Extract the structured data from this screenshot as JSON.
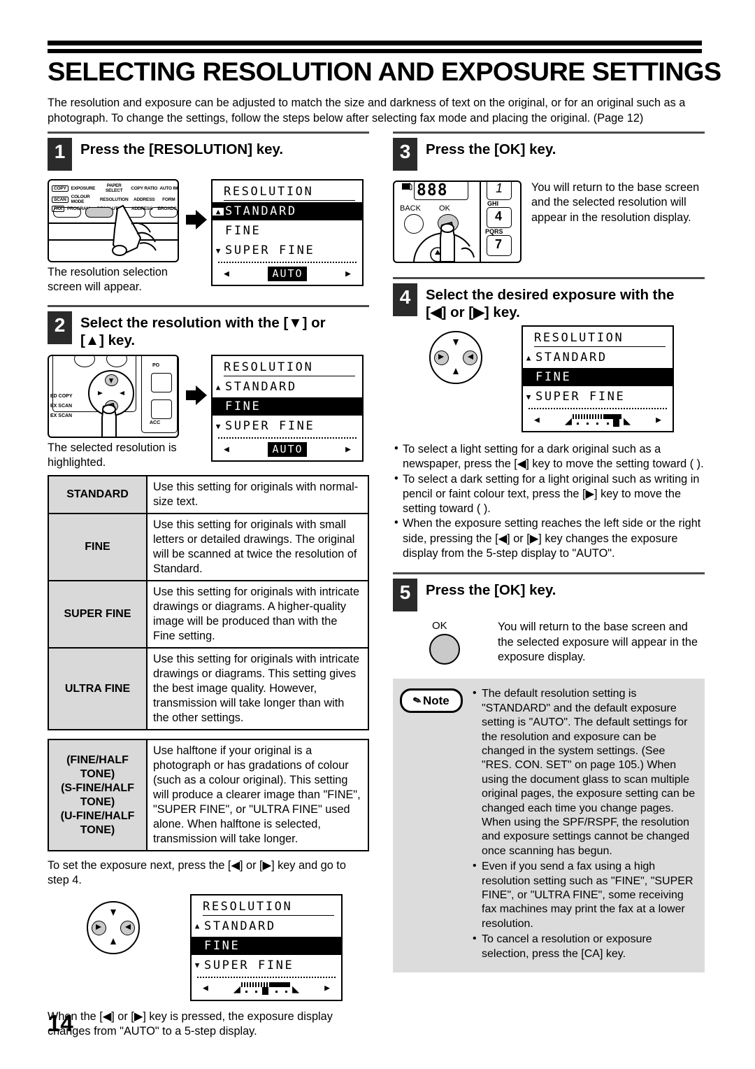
{
  "document": {
    "title": "SELECTING RESOLUTION AND EXPOSURE SETTINGS",
    "intro": "The resolution and exposure can be adjusted to match the size and darkness of text on the original, or for an original such as a photograph. To change the settings, follow the steps below after selecting fax mode and placing the original. (Page 12)",
    "page_number": "14"
  },
  "steps": {
    "s1": {
      "num": "1",
      "heading": "Press the [RESOLUTION] key.",
      "caption": "The resolution selection screen will appear."
    },
    "s2": {
      "num": "2",
      "heading_line1": "Select the resolution with the [▼] or",
      "heading_line2": "[▲] key.",
      "caption": "The selected resolution is highlighted."
    },
    "s3": {
      "num": "3",
      "heading": "Press the [OK] key.",
      "body": "You will return to the base screen and the selected resolution will appear in the resolution display."
    },
    "s4": {
      "num": "4",
      "heading_line1": "Select the desired exposure with the",
      "heading_line2": "[◀] or [▶] key."
    },
    "s5": {
      "num": "5",
      "heading": "Press the [OK] key.",
      "body": "You will return to the base screen and the selected exposure will appear in the exposure display."
    }
  },
  "lcd": {
    "title": "RESOLUTION",
    "items": [
      "STANDARD",
      "FINE",
      "SUPER FINE"
    ],
    "auto_label": "AUTO",
    "left_tri": "◀",
    "right_tri": "▶",
    "up_caret": "▲",
    "down_caret": "▼",
    "screen1_selected": "STANDARD",
    "screen2_selected": "FINE",
    "screen3_selected": "FINE",
    "screen4_selected": "FINE"
  },
  "control_panel": {
    "row1": [
      "COPY",
      "EXPOSURE",
      "PAPER SELECT",
      "COPY RATIO",
      "AUTO IM"
    ],
    "row2": [
      "SCAN",
      "COLOUR MODE",
      "RESOLUTION",
      "ADDRESS",
      "FORM"
    ],
    "row3": [
      "FAX",
      "PROGRAM",
      "RESOLUTION",
      "ADDRESS",
      "BROADC"
    ],
    "step2_labels": [
      "ED COPY",
      "EX SCAN",
      "EX SCAN",
      "PO",
      "ACC"
    ],
    "step3_labels": {
      "back": "BACK",
      "ok": "OK",
      "key1": "1",
      "key4": "4",
      "key7": "7",
      "ghi": "GHI",
      "pqrs": "PQRS",
      "display": "888"
    },
    "step5_ok": "OK"
  },
  "resolution_table": {
    "rows": [
      {
        "name": "STANDARD",
        "desc": "Use this setting for originals with normal-size text."
      },
      {
        "name": "FINE",
        "desc": "Use this setting for originals with small letters or detailed drawings. The original will be scanned at twice the resolution of Standard."
      },
      {
        "name": "SUPER FINE",
        "desc": "Use this setting for originals with intricate drawings or diagrams. A higher-quality image will be produced than with the Fine setting."
      },
      {
        "name": "ULTRA FINE",
        "desc": "Use this setting for originals with intricate drawings or diagrams. This setting gives the best image quality. However, transmission will take longer than with the other settings."
      }
    ]
  },
  "halftone_table": {
    "name_lines": [
      "(FINE/HALF",
      "TONE)",
      "(S-FINE/HALF",
      "TONE)",
      "(U-FINE/HALF",
      "TONE)"
    ],
    "desc": "Use halftone if your original is a photograph or has gradations of colour (such as a colour original). This setting will produce a clearer image than \"FINE\", \"SUPER FINE\", or \"ULTRA FINE\" used alone. When halftone is selected, transmission will take longer."
  },
  "left_bottom": {
    "para1": "To set the exposure next, press the [◀] or [▶] key and go to step 4.",
    "para2": "When the [◀] or [▶] key is pressed, the exposure display changes from \"AUTO\" to a 5-step display."
  },
  "exposure_bullets": [
    "To select a light setting for a dark original such as a newspaper, press the [◀] key to move the setting toward (  ).",
    "To select a dark setting for a light original such as writing in pencil or faint colour text, press the [▶] key to move the setting toward (  ).",
    "When the exposure setting reaches the left side or the right side, pressing the [◀] or [▶] key changes the exposure display from the 5-step display to \"AUTO\"."
  ],
  "note": {
    "label": "Note",
    "items": [
      "The default resolution setting is \"STANDARD\" and the default exposure setting is \"AUTO\". The default settings for the resolution and exposure can be changed in the system settings. (See \"RES. CON. SET\" on page 105.) When using the document glass to scan multiple original pages, the exposure setting can be changed each time you change pages. When using the SPF/RSPF, the resolution and exposure settings cannot be changed once scanning has begun.",
      "Even if you send a fax using a high resolution setting such as \"FINE\", \"SUPER FINE\", or \"ULTRA FINE\", some receiving fax machines may print the fax at a lower resolution.",
      "To cancel a resolution or exposure selection, press the [CA] key."
    ]
  }
}
